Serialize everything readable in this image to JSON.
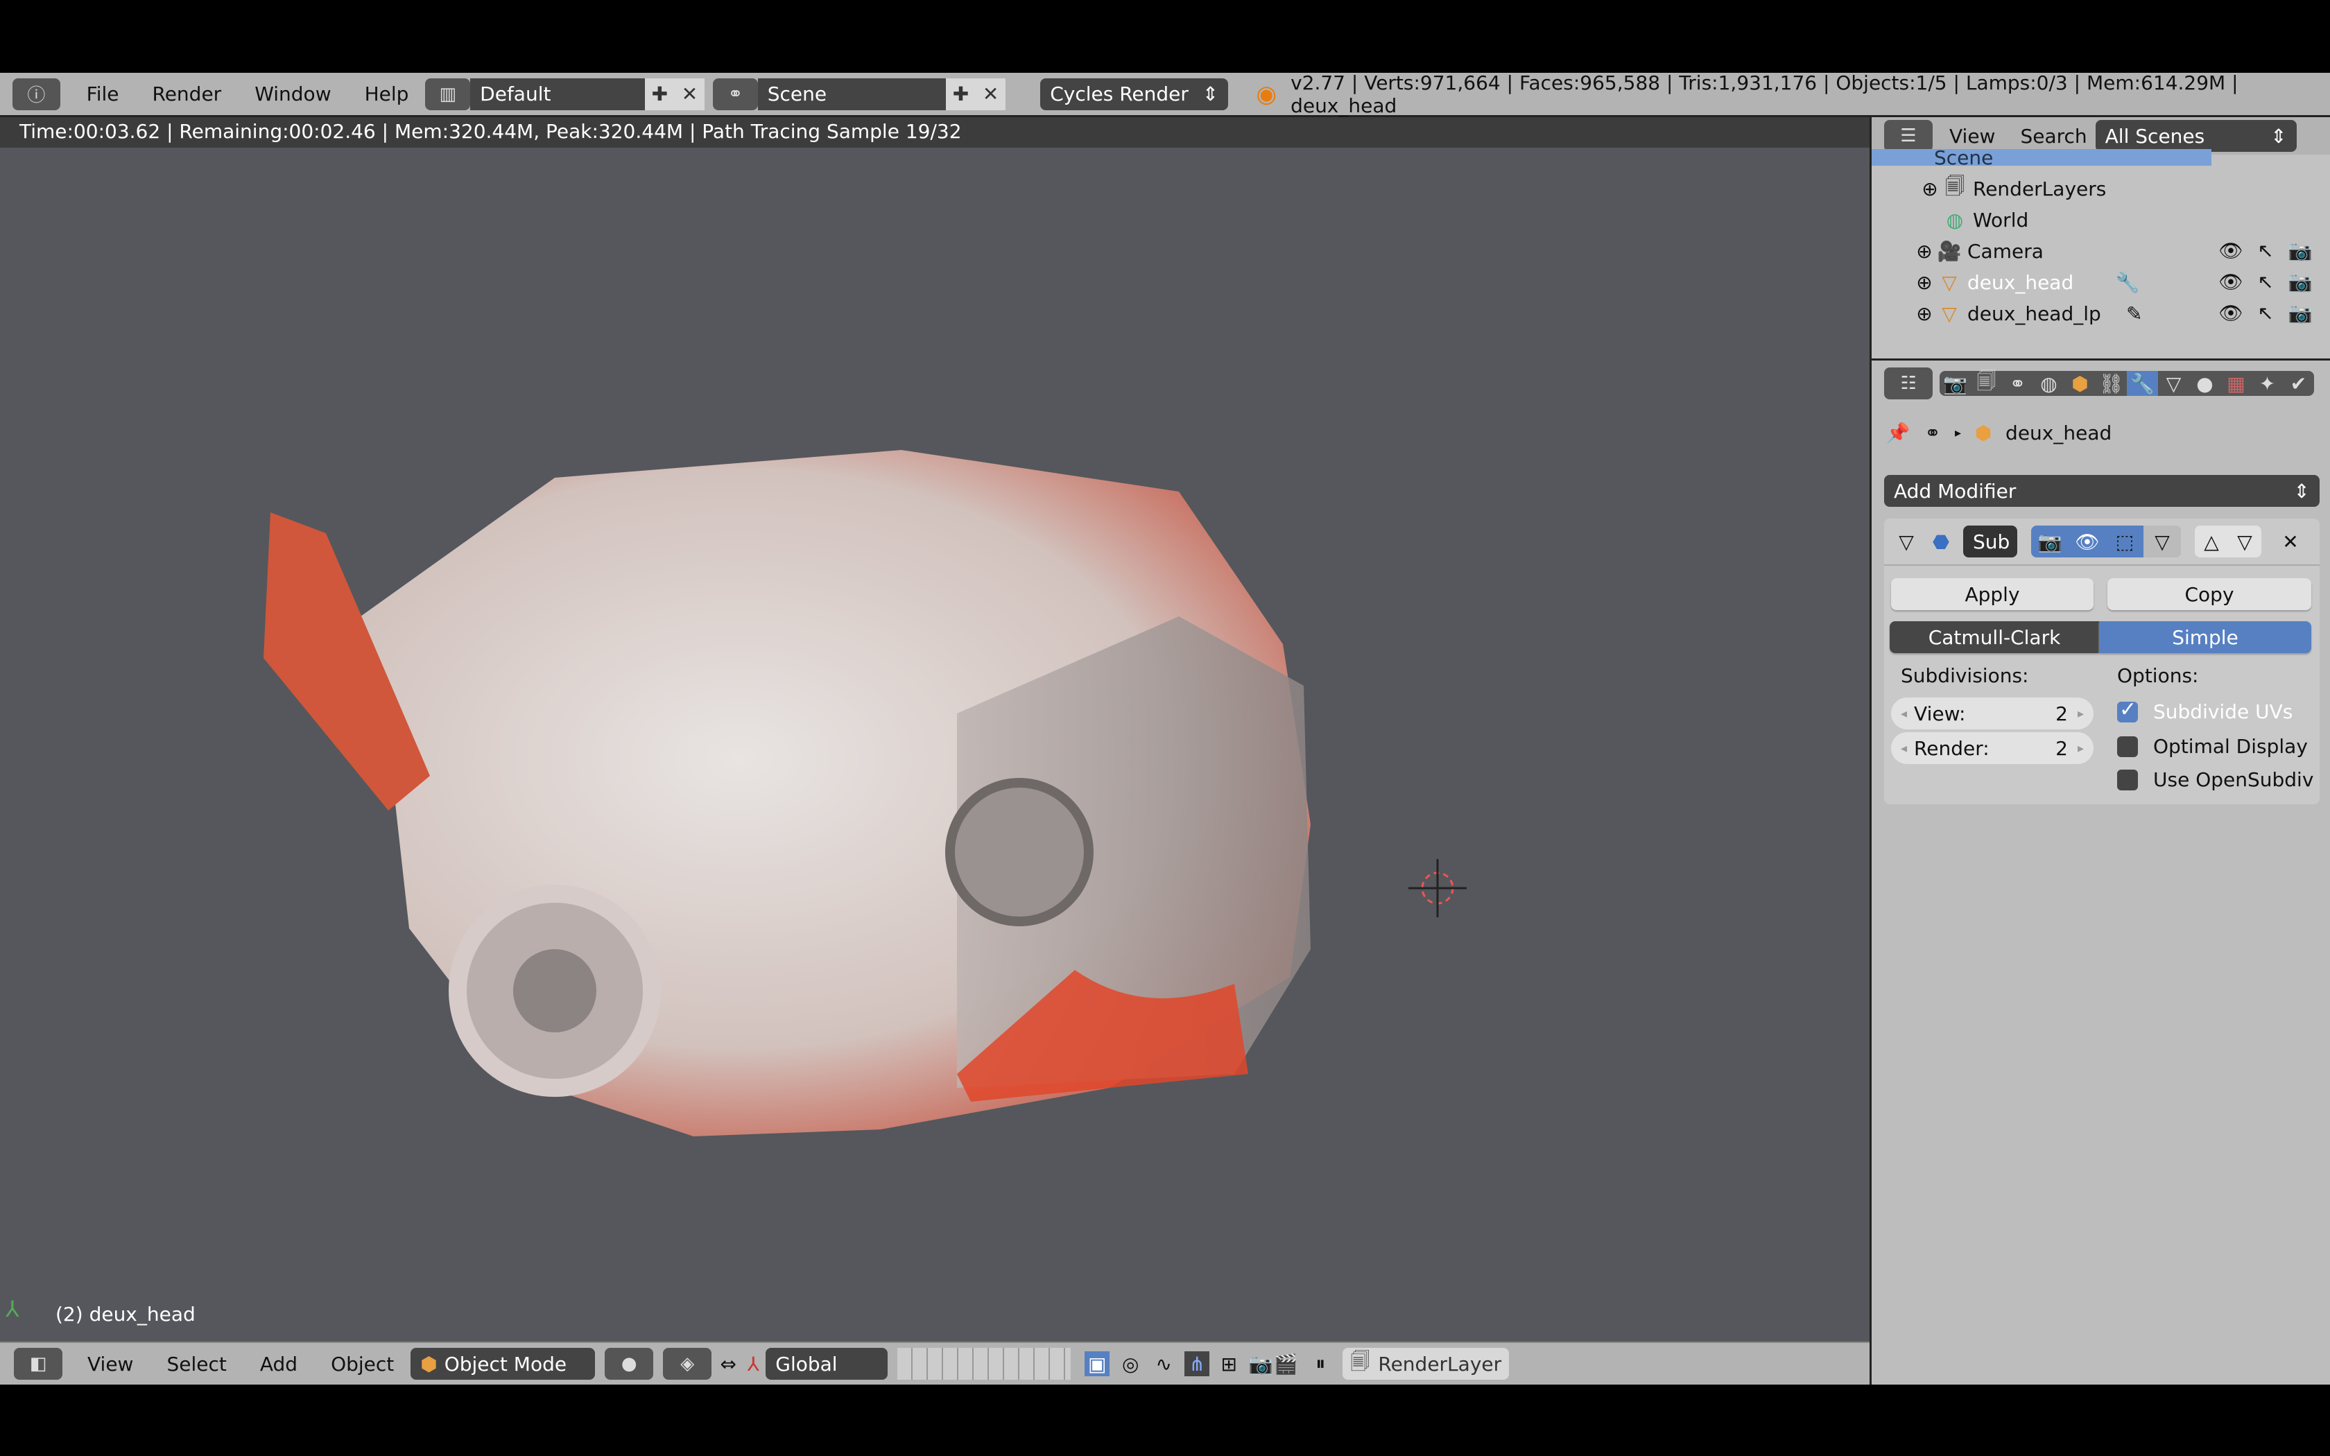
{
  "top_bar": {
    "menus": [
      "File",
      "Render",
      "Window",
      "Help"
    ],
    "layout": "Default",
    "scene": "Scene",
    "engine": "Cycles Render",
    "stats": "v2.77 | Verts:971,664 | Faces:965,588 | Tris:1,931,176 | Objects:1/5 | Lamps:0/3 | Mem:614.29M | deux_head"
  },
  "viewport": {
    "render_info": "Time:00:03.62 | Remaining:00:02.46 | Mem:320.44M, Peak:320.44M | Path Tracing Sample 19/32",
    "object_label": "(2) deux_head",
    "background": "#55575c"
  },
  "bottom_bar": {
    "menus": [
      "View",
      "Select",
      "Add",
      "Object"
    ],
    "mode": "Object Mode",
    "orientation": "Global",
    "render_layer": "RenderLayer"
  },
  "outliner": {
    "menus": [
      "View",
      "Search"
    ],
    "filter": "All Scenes",
    "items": [
      {
        "label": "Scene",
        "icon": "scene-icon",
        "selected": true
      },
      {
        "label": "RenderLayers",
        "icon": "renderlayers-icon"
      },
      {
        "label": "World",
        "icon": "world-icon"
      },
      {
        "label": "Camera",
        "icon": "camera-icon"
      },
      {
        "label": "deux_head",
        "icon": "mesh-icon",
        "active": true
      },
      {
        "label": "deux_head_lp",
        "icon": "mesh-icon"
      }
    ]
  },
  "properties": {
    "context_object": "deux_head",
    "active_tab": "modifiers",
    "add_modifier": "Add Modifier",
    "modifier": {
      "name": "Sub",
      "apply": "Apply",
      "copy": "Copy",
      "types": [
        "Catmull-Clark",
        "Simple"
      ],
      "selected_type": "Simple",
      "subdivisions_label": "Subdivisions:",
      "view_label": "View:",
      "view_value": "2",
      "render_label": "Render:",
      "render_value": "2",
      "options_label": "Options:",
      "options": [
        {
          "label": "Subdivide UVs",
          "checked": true
        },
        {
          "label": "Optimal Display",
          "checked": false
        },
        {
          "label": "Use OpenSubdiv",
          "checked": false
        }
      ]
    }
  },
  "colors": {
    "accent": "#5680c2",
    "header": "#b3b3b3",
    "panel": "#bdbdbd",
    "paint": "#e0472a"
  }
}
